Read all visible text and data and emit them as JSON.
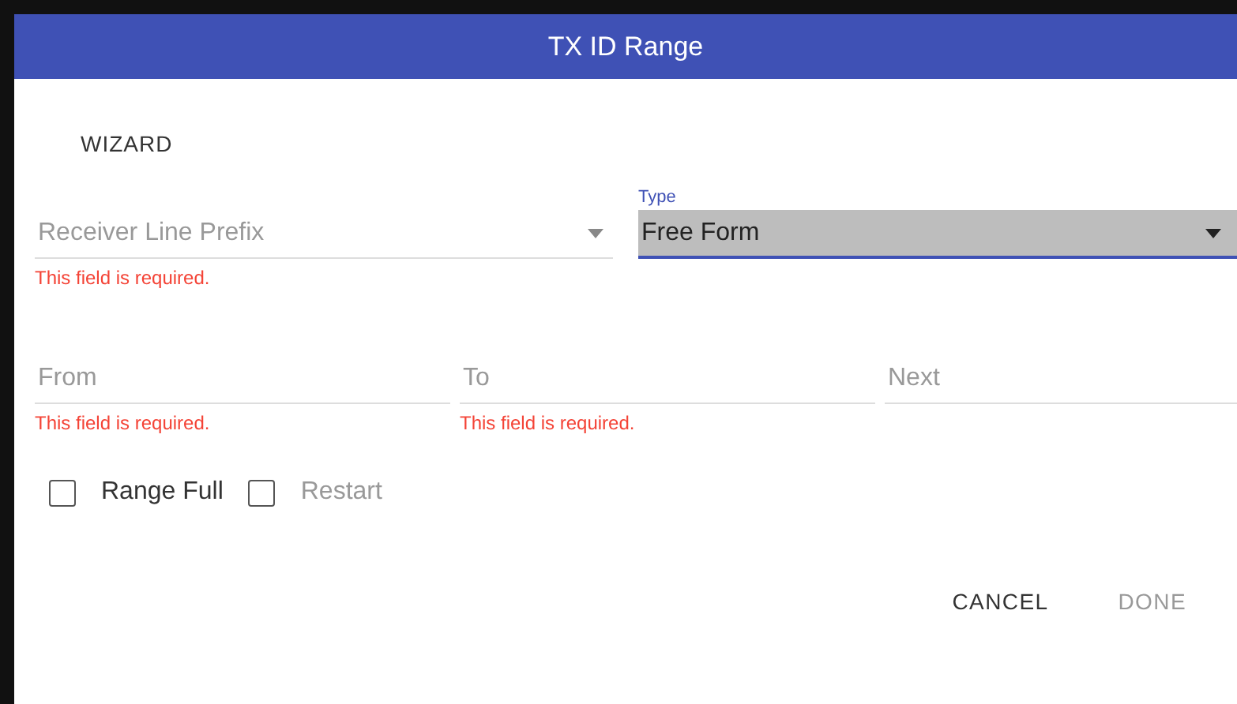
{
  "window": {
    "title": "TX ID Range"
  },
  "wizard_label": "WIZARD",
  "row_1": [
    {
      "kind": "select",
      "placeholder": "Receiver Line Prefix",
      "focused": false,
      "error": "This field is required."
    },
    {
      "kind": "select",
      "label": "Type",
      "value": "Free Form",
      "focused": true
    }
  ],
  "row_2": [
    {
      "kind": "text",
      "placeholder": "From",
      "error": "This field is required."
    },
    {
      "kind": "text",
      "placeholder": "To",
      "error": "This field is required."
    },
    {
      "kind": "text",
      "placeholder": "Next"
    }
  ],
  "checkboxes": [
    {
      "label": "Range Full",
      "checked": false,
      "disabled": false
    },
    {
      "label": "Restart",
      "checked": false,
      "disabled": true
    }
  ],
  "buttons": [
    {
      "label": "CANCEL",
      "disabled": false
    },
    {
      "label": "DONE",
      "disabled": true
    }
  ]
}
